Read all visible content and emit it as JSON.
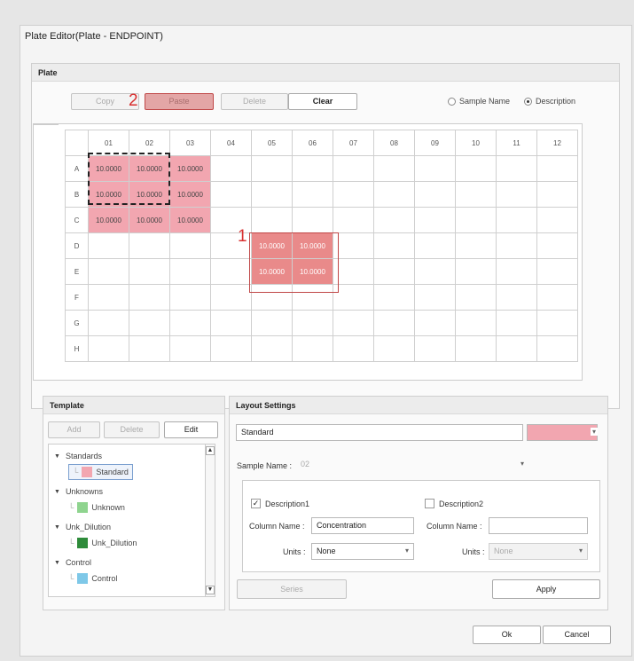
{
  "window": {
    "title": "Plate Editor(Plate - ENDPOINT)"
  },
  "plate": {
    "panel_title": "Plate",
    "buttons": {
      "copy": "Copy",
      "paste": "Paste",
      "delete": "Delete",
      "clear": "Clear"
    },
    "markers": {
      "one": "1",
      "two": "2"
    },
    "radio": {
      "sample_name": "Sample Name",
      "description": "Description",
      "selected": "Description"
    },
    "columns": [
      "01",
      "02",
      "03",
      "04",
      "05",
      "06",
      "07",
      "08",
      "09",
      "10",
      "11",
      "12"
    ],
    "rows": [
      {
        "label": "A",
        "cells": [
          "10.0000",
          "10.0000",
          "10.0000",
          "",
          "",
          "",
          "",
          "",
          "",
          "",
          "",
          ""
        ]
      },
      {
        "label": "B",
        "cells": [
          "10.0000",
          "10.0000",
          "10.0000",
          "",
          "",
          "",
          "",
          "",
          "",
          "",
          "",
          ""
        ]
      },
      {
        "label": "C",
        "cells": [
          "10.0000",
          "10.0000",
          "10.0000",
          "",
          "",
          "",
          "",
          "",
          "",
          "",
          "",
          ""
        ]
      },
      {
        "label": "D",
        "cells": [
          "",
          "",
          "",
          "",
          "10.0000",
          "10.0000",
          "",
          "",
          "",
          "",
          "",
          ""
        ]
      },
      {
        "label": "E",
        "cells": [
          "",
          "",
          "",
          "",
          "10.0000",
          "10.0000",
          "",
          "",
          "",
          "",
          "",
          ""
        ]
      },
      {
        "label": "F",
        "cells": [
          "",
          "",
          "",
          "",
          "",
          "",
          "",
          "",
          "",
          "",
          "",
          ""
        ]
      },
      {
        "label": "G",
        "cells": [
          "",
          "",
          "",
          "",
          "",
          "",
          "",
          "",
          "",
          "",
          "",
          ""
        ]
      },
      {
        "label": "H",
        "cells": [
          "",
          "",
          "",
          "",
          "",
          "",
          "",
          "",
          "",
          "",
          "",
          ""
        ]
      }
    ],
    "colors": {
      "standard": "#f2a6b0",
      "selected": "#e98a8a"
    }
  },
  "template": {
    "panel_title": "Template",
    "buttons": {
      "add": "Add",
      "delete": "Delete",
      "edit": "Edit"
    },
    "tree": [
      {
        "group": "Standards",
        "item": "Standard",
        "color": "#f2a6b0"
      },
      {
        "group": "Unknowns",
        "item": "Unknown",
        "color": "#8fd48f"
      },
      {
        "group": "Unk_Dilution",
        "item": "Unk_Dilution",
        "color": "#2e8b3a"
      },
      {
        "group": "Control",
        "item": "Control",
        "color": "#7ec8e8"
      }
    ]
  },
  "layout": {
    "panel_title": "Layout Settings",
    "name_value": "Standard",
    "color": "#f2a6b0",
    "sample_name_label": "Sample Name :",
    "sample_name_value": "02",
    "desc1": {
      "label": "Description1",
      "checked": true,
      "column_name_label": "Column Name :",
      "column_name_value": "Concentration",
      "units_label": "Units :",
      "units_value": "None"
    },
    "desc2": {
      "label": "Description2",
      "checked": false,
      "column_name_label": "Column Name :",
      "column_name_value": "",
      "units_label": "Units :",
      "units_value": "None"
    },
    "buttons": {
      "series": "Series",
      "apply": "Apply"
    }
  },
  "footer": {
    "ok": "Ok",
    "cancel": "Cancel"
  }
}
